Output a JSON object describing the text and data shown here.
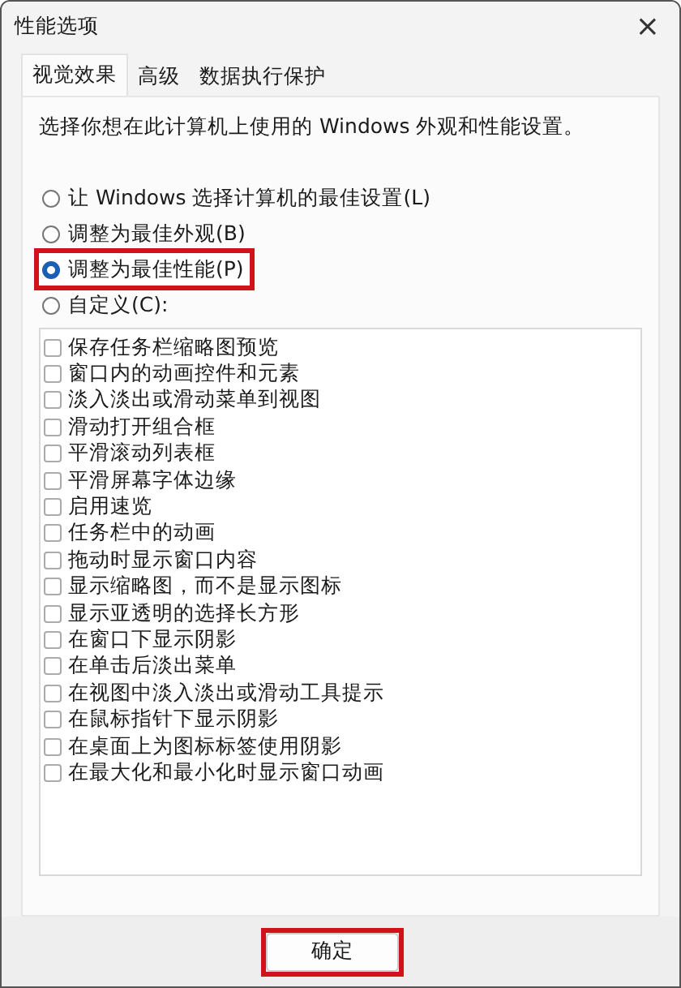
{
  "window": {
    "title": "性能选项",
    "close": "×"
  },
  "tabs": [
    {
      "label": "视觉效果",
      "selected": true
    },
    {
      "label": "高级",
      "selected": false
    },
    {
      "label": "数据执行保护",
      "selected": false
    }
  ],
  "description": "选择你想在此计算机上使用的 Windows 外观和性能设置。",
  "options": [
    {
      "label": "让 Windows 选择计算机的最佳设置(L)",
      "selected": false,
      "highlighted": false
    },
    {
      "label": "调整为最佳外观(B)",
      "selected": false,
      "highlighted": false
    },
    {
      "label": "调整为最佳性能(P)",
      "selected": true,
      "highlighted": true
    },
    {
      "label": "自定义(C):",
      "selected": false,
      "highlighted": false
    }
  ],
  "effects": [
    {
      "label": "保存任务栏缩略图预览",
      "checked": false
    },
    {
      "label": "窗口内的动画控件和元素",
      "checked": false
    },
    {
      "label": "淡入淡出或滑动菜单到视图",
      "checked": false
    },
    {
      "label": "滑动打开组合框",
      "checked": false
    },
    {
      "label": "平滑滚动列表框",
      "checked": false
    },
    {
      "label": "平滑屏幕字体边缘",
      "checked": false
    },
    {
      "label": "启用速览",
      "checked": false
    },
    {
      "label": "任务栏中的动画",
      "checked": false
    },
    {
      "label": "拖动时显示窗口内容",
      "checked": false
    },
    {
      "label": "显示缩略图，而不是显示图标",
      "checked": false
    },
    {
      "label": "显示亚透明的选择长方形",
      "checked": false
    },
    {
      "label": "在窗口下显示阴影",
      "checked": false
    },
    {
      "label": "在单击后淡出菜单",
      "checked": false
    },
    {
      "label": "在视图中淡入淡出或滑动工具提示",
      "checked": false
    },
    {
      "label": "在鼠标指针下显示阴影",
      "checked": false
    },
    {
      "label": "在桌面上为图标标签使用阴影",
      "checked": false
    },
    {
      "label": "在最大化和最小化时显示窗口动画",
      "checked": false
    }
  ],
  "buttons": [
    {
      "label": "确定",
      "highlighted": true
    }
  ]
}
